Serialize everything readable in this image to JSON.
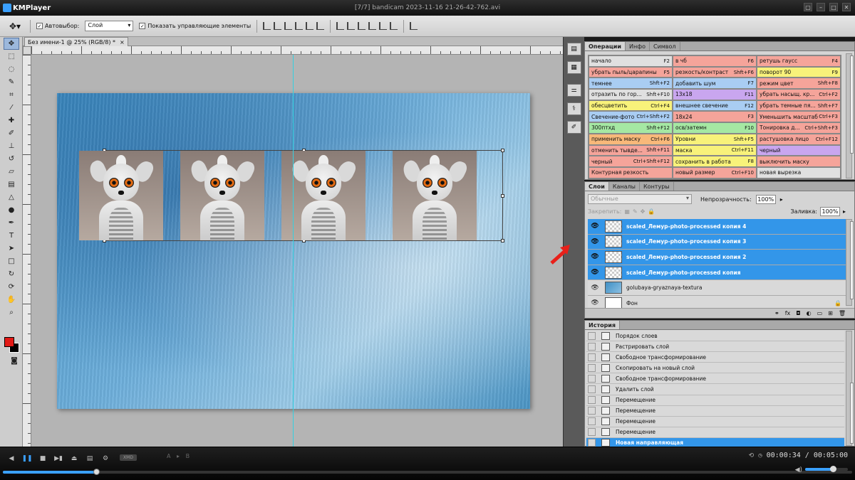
{
  "player": {
    "app_name": "KMPlayer",
    "file_title": "[7/7] bandicam 2023-11-16 21-26-42-762.avi",
    "current_time": "00:00:34",
    "total_time": "00:05:00",
    "time_separator": "/",
    "badge": "XMD",
    "abr": "A ▸ B",
    "progress": 0.11,
    "volume": 0.65
  },
  "options_bar": {
    "auto_select_label": "Автовыбор:",
    "auto_select_value": "Слой",
    "show_controls_label": "Показать управляющие элементы"
  },
  "document": {
    "tab_title": "Без имени-1 @ 25% (RGB/8) *",
    "close": "×"
  },
  "actions_panel": {
    "tabs": [
      "Операции",
      "Инфо",
      "Символ"
    ],
    "colors": {
      "gray": "#e0e0e0",
      "red": "#f5a49a",
      "blue": "#a9cdf3",
      "yellow": "#f8f27a",
      "green": "#a5e8a3",
      "violet": "#c9a6ef",
      "orange": "#f8b97a"
    },
    "items": [
      {
        "name": "начало",
        "key": "F2",
        "color": "gray"
      },
      {
        "name": "в чб",
        "key": "F6",
        "color": "red"
      },
      {
        "name": "ретушь гаусс",
        "key": "F4",
        "color": "red"
      },
      {
        "name": "убрать пыль/царапины",
        "key": "F5",
        "color": "red"
      },
      {
        "name": "резкость/контраст",
        "key": "Shft+F6",
        "color": "red"
      },
      {
        "name": "поворот 90",
        "key": "F9",
        "color": "yellow"
      },
      {
        "name": "темнее",
        "key": "Shft+F2",
        "color": "blue"
      },
      {
        "name": "добавить шум",
        "key": "F7",
        "color": "blue"
      },
      {
        "name": "режим цвет",
        "key": "Shft+F8",
        "color": "red"
      },
      {
        "name": "отразить по гор...",
        "key": "Shft+F10",
        "color": "gray"
      },
      {
        "name": "13x18",
        "key": "F11",
        "color": "violet"
      },
      {
        "name": "убрать насыщ. кр...",
        "key": "Ctrl+F2",
        "color": "red"
      },
      {
        "name": "обесцветить",
        "key": "Ctrl+F4",
        "color": "yellow"
      },
      {
        "name": "внешнее свечение",
        "key": "F12",
        "color": "blue"
      },
      {
        "name": "убрать темные пя...",
        "key": "Shft+F7",
        "color": "red"
      },
      {
        "name": "Свечение-фото",
        "key": "Ctrl+Shft+F2",
        "color": "blue"
      },
      {
        "name": "18x24",
        "key": "F3",
        "color": "red"
      },
      {
        "name": "Уменьшить масштаб",
        "key": "Ctrl+F3",
        "color": "red"
      },
      {
        "name": "300птхд",
        "key": "Shft+F12",
        "color": "green"
      },
      {
        "name": "осв/затемн",
        "key": "F10",
        "color": "green"
      },
      {
        "name": "Тонировка д...",
        "key": "Ctrl+Shft+F3",
        "color": "red"
      },
      {
        "name": "применить маску",
        "key": "Ctrl+F6",
        "color": "orange"
      },
      {
        "name": "Уровни",
        "key": "Shft+F5",
        "color": "yellow"
      },
      {
        "name": "растушовка лицо",
        "key": "Ctrl+F12",
        "color": "red"
      },
      {
        "name": "отменить тывде...",
        "key": "Shft+F11",
        "color": "red"
      },
      {
        "name": "маска",
        "key": "Ctrl+F11",
        "color": "yellow"
      },
      {
        "name": "черный",
        "key": "",
        "color": "violet"
      },
      {
        "name": "черный",
        "key": "Ctrl+Shft+F12",
        "color": "red"
      },
      {
        "name": "сохранить в работа",
        "key": "F8",
        "color": "yellow"
      },
      {
        "name": "выключить маску",
        "key": "",
        "color": "red"
      },
      {
        "name": "Контурная резкость",
        "key": "",
        "color": "red"
      },
      {
        "name": "новый размер",
        "key": "Ctrl+F10",
        "color": "red"
      },
      {
        "name": "новая вырезка",
        "key": "",
        "color": "gray"
      }
    ]
  },
  "layers_panel": {
    "tabs": [
      "Слои",
      "Каналы",
      "Контуры"
    ],
    "blend_mode": "Обычные",
    "opacity_label": "Непрозрачность:",
    "opacity_value": "100%",
    "lock_label": "Закрепить:",
    "fill_label": "Заливка:",
    "fill_value": "100%",
    "layers": [
      {
        "name": "scaled_Лемур-photo-processed копия 4",
        "selected": true,
        "thumb": "checker"
      },
      {
        "name": "scaled_Лемур-photo-processed копия 3",
        "selected": true,
        "thumb": "checker"
      },
      {
        "name": "scaled_Лемур-photo-processed копия 2",
        "selected": true,
        "thumb": "checker"
      },
      {
        "name": "scaled_Лемур-photo-processed копия",
        "selected": true,
        "thumb": "checker"
      },
      {
        "name": "golubaya-gryaznaya-textura",
        "selected": false,
        "thumb": "texture"
      },
      {
        "name": "Фон",
        "selected": false,
        "thumb": "white",
        "locked": true
      }
    ]
  },
  "history_panel": {
    "tabs": [
      "История"
    ],
    "items": [
      {
        "label": "Порядок слоев",
        "selected": false
      },
      {
        "label": "Растрировать слой",
        "selected": false
      },
      {
        "label": "Свободное трансформирование",
        "selected": false
      },
      {
        "label": "Скопировать на новый слой",
        "selected": false
      },
      {
        "label": "Свободное трансформирование",
        "selected": false
      },
      {
        "label": "Удалить слой",
        "selected": false
      },
      {
        "label": "Перемещение",
        "selected": false
      },
      {
        "label": "Перемещение",
        "selected": false
      },
      {
        "label": "Перемещение",
        "selected": false
      },
      {
        "label": "Перемещение",
        "selected": false
      },
      {
        "label": "Новая направляющая",
        "selected": true
      }
    ]
  },
  "tools": [
    "move-tool",
    "marquee-tool",
    "lasso-tool",
    "quick-select-tool",
    "crop-tool",
    "eyedropper-tool",
    "healing-brush-tool",
    "brush-tool",
    "clone-stamp-tool",
    "history-brush-tool",
    "eraser-tool",
    "gradient-tool",
    "blur-tool",
    "dodge-tool",
    "pen-tool",
    "type-tool",
    "path-select-tool",
    "shape-tool",
    "3d-rotate-tool",
    "3d-orbit-tool",
    "hand-tool",
    "zoom-tool"
  ],
  "swatches": {
    "foreground": "#e21a16",
    "background": "#000000"
  }
}
